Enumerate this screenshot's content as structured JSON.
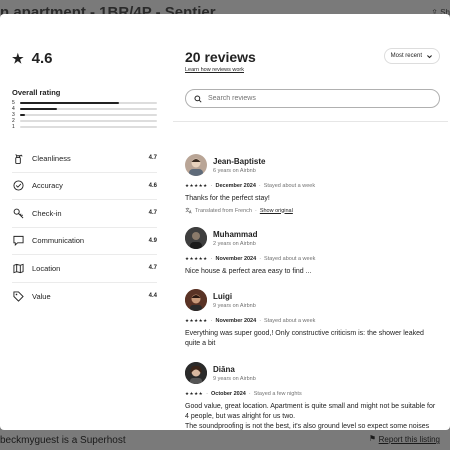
{
  "background": {
    "title": "n apartment - 1BR/4P - Sentier",
    "share": "⇪ Sh",
    "superhost": "beckmyguest is a Superhost",
    "report": "Report this listing"
  },
  "rating": {
    "value": "4.6",
    "overall_label": "Overall rating",
    "distribution": [
      {
        "stars": "5",
        "fraction": 0.72
      },
      {
        "stars": "4",
        "fraction": 0.27
      },
      {
        "stars": "3",
        "fraction": 0.04
      },
      {
        "stars": "2",
        "fraction": 0.0
      },
      {
        "stars": "1",
        "fraction": 0.0
      }
    ],
    "categories": [
      {
        "label": "Cleanliness",
        "value": "4.7",
        "icon": "spray-bottle-icon"
      },
      {
        "label": "Accuracy",
        "value": "4.6",
        "icon": "check-circle-icon"
      },
      {
        "label": "Check-in",
        "value": "4.7",
        "icon": "key-icon"
      },
      {
        "label": "Communication",
        "value": "4.9",
        "icon": "message-icon"
      },
      {
        "label": "Location",
        "value": "4.7",
        "icon": "map-icon"
      },
      {
        "label": "Value",
        "value": "4.4",
        "icon": "tag-icon"
      }
    ]
  },
  "reviews_panel": {
    "title": "20 reviews",
    "learn_link": "Learn how reviews work",
    "sort_label": "Most recent",
    "search_placeholder": "Search reviews"
  },
  "reviews": [
    {
      "name": "Jean-Baptiste",
      "tenure": "6 years on Airbnb",
      "stars": "★★★★★",
      "date": "December 2024",
      "stay": "Stayed about a week",
      "text": "Thanks for the perfect stay!",
      "translated_note": "Translated from French",
      "show_original": "Show original",
      "avatar_color": "#b9a596"
    },
    {
      "name": "Muhammad",
      "tenure": "2 years on Airbnb",
      "stars": "★★★★★",
      "date": "November 2024",
      "stay": "Stayed about a week",
      "text": "Nice house & perfect area easy to find ...",
      "avatar_color": "#4a4a4a"
    },
    {
      "name": "Luigi",
      "tenure": "9 years on Airbnb",
      "stars": "★★★★★",
      "date": "November 2024",
      "stay": "Stayed about a week",
      "text": "Everything was super good,! Only constructive criticism is: the shower leaked quite a bit",
      "avatar_color": "#6b3a2a"
    },
    {
      "name": "Diāna",
      "tenure": "9 years on Airbnb",
      "stars": "★★★★",
      "date": "October 2024",
      "stay": "Stayed a few nights",
      "text": "Good value, great location. Apartment is quite small and might not be suitable for 4 people, but was alright for us two.\nThe soundproofing is not the best, it's also ground level so expect some noises from the street and the other airbnb next door.",
      "avatar_color": "#2f2f2f"
    }
  ]
}
